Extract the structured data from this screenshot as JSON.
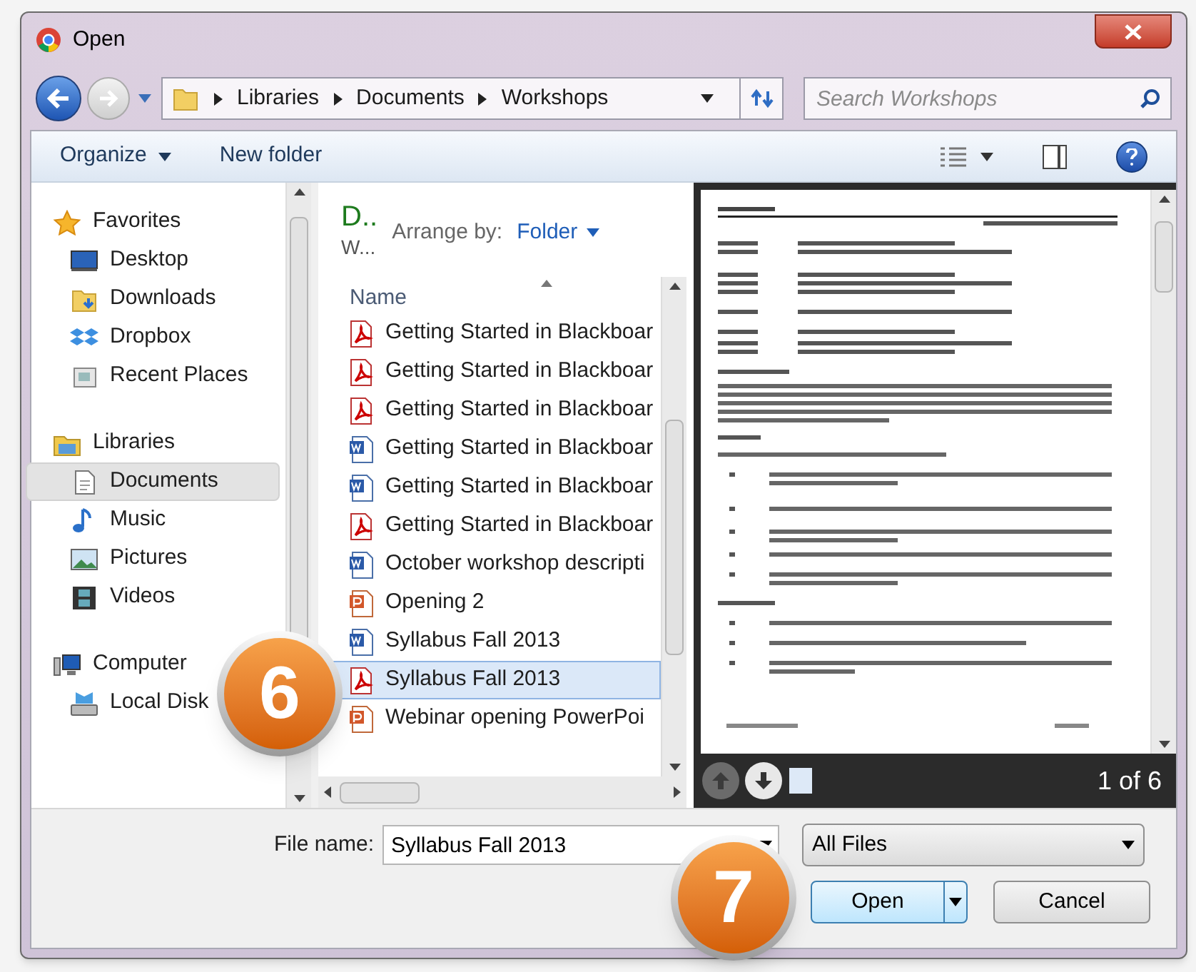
{
  "window": {
    "title": "Open"
  },
  "address": {
    "path": [
      "Libraries",
      "Documents",
      "Workshops"
    ]
  },
  "search": {
    "placeholder": "Search Workshops"
  },
  "toolbar": {
    "organize": "Organize",
    "new_folder": "New folder"
  },
  "navigation": [
    {
      "label": "Favorites",
      "kind": "star",
      "selected": false,
      "children": [
        {
          "label": "Desktop",
          "kind": "desktop",
          "selected": false
        },
        {
          "label": "Downloads",
          "kind": "downloads",
          "selected": false
        },
        {
          "label": "Dropbox",
          "kind": "dropbox",
          "selected": false
        },
        {
          "label": "Recent Places",
          "kind": "recent",
          "selected": false
        }
      ]
    },
    {
      "label": "Libraries",
      "kind": "library",
      "selected": false,
      "children": [
        {
          "label": "Documents",
          "kind": "documents",
          "selected": true
        },
        {
          "label": "Music",
          "kind": "music",
          "selected": false
        },
        {
          "label": "Pictures",
          "kind": "pictures",
          "selected": false
        },
        {
          "label": "Videos",
          "kind": "videos",
          "selected": false
        }
      ]
    },
    {
      "label": "Computer",
      "kind": "computer",
      "selected": false,
      "children": [
        {
          "label": "Local Disk",
          "kind": "disk",
          "selected": false
        }
      ]
    }
  ],
  "library_header": {
    "title": "D..",
    "subtitle": "W...",
    "arrange_label": "Arrange by:",
    "arrange_value": "Folder"
  },
  "files_column": "Name",
  "files": [
    {
      "name": "Getting Started in Blackboar",
      "kind": "pdf",
      "selected": false
    },
    {
      "name": "Getting Started in Blackboar",
      "kind": "pdf",
      "selected": false
    },
    {
      "name": "Getting Started in Blackboar",
      "kind": "pdf",
      "selected": false
    },
    {
      "name": "Getting Started in Blackboar",
      "kind": "word",
      "selected": false
    },
    {
      "name": "Getting Started in Blackboar",
      "kind": "word",
      "selected": false
    },
    {
      "name": "Getting Started in Blackboar",
      "kind": "pdf",
      "selected": false
    },
    {
      "name": "October workshop descripti",
      "kind": "word",
      "selected": false
    },
    {
      "name": "Opening 2",
      "kind": "powerpoint",
      "selected": false
    },
    {
      "name": "Syllabus Fall 2013",
      "kind": "word",
      "selected": false
    },
    {
      "name": "Syllabus Fall 2013",
      "kind": "pdf",
      "selected": true
    },
    {
      "name": "Webinar opening PowerPoi",
      "kind": "powerpoint",
      "selected": false
    }
  ],
  "preview": {
    "page_counter": "1 of 6"
  },
  "file_name": {
    "label": "File name:",
    "value": "Syllabus Fall 2013"
  },
  "file_type": "All Files",
  "buttons": [
    "Open",
    "Cancel"
  ],
  "callouts": [
    "6",
    "7"
  ]
}
